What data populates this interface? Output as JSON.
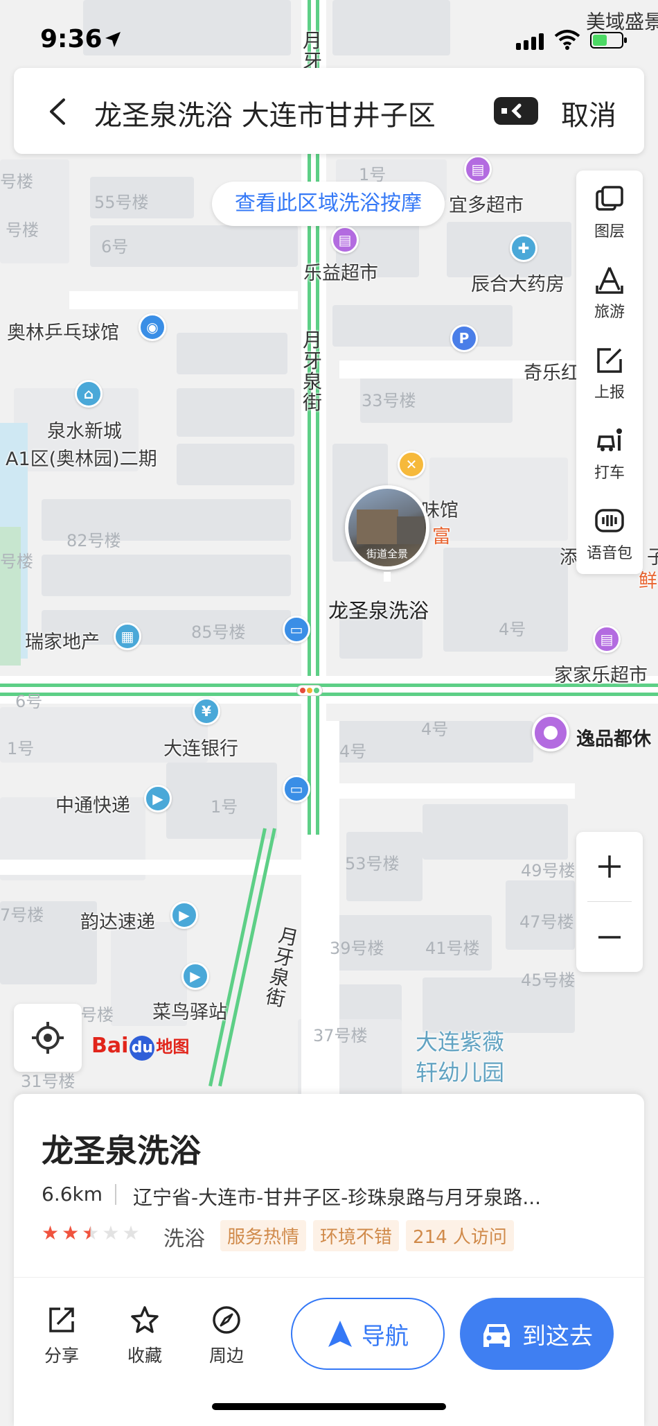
{
  "status_bar": {
    "time": "9:36",
    "top_right_text": "美域盛景"
  },
  "search": {
    "query": "龙圣泉洗浴 大连市甘井子区",
    "cancel_label": "取消"
  },
  "region_pill": "查看此区域洗浴按摩",
  "toolbar": [
    {
      "label": "图层",
      "icon": "layers-icon"
    },
    {
      "label": "旅游",
      "icon": "travel-icon"
    },
    {
      "label": "上报",
      "icon": "report-icon"
    },
    {
      "label": "打车",
      "icon": "taxi-icon"
    },
    {
      "label": "语音包",
      "icon": "voice-pack-icon"
    }
  ],
  "map": {
    "roads": {
      "main": "月牙泉街",
      "main_lower": "月牙泉街"
    },
    "pois": {
      "yiduo": "宜多超市",
      "leyi": "乐益超市",
      "chenhe": "辰合大药房",
      "aolin": "奥林乒乓球馆",
      "quanshui": "泉水新城",
      "quanshui2": "A1区(奥林园)二期",
      "qile": "奇乐红",
      "weiguan": "味馆",
      "fu": "富",
      "ruijia": "瑞家地产",
      "jiajiale": "家家乐超市",
      "dalianbank": "大连银行",
      "yipin": "逸品都休",
      "zhongtong": "中通快递",
      "yunda": "韵达速递",
      "cainiao": "菜鸟驿站",
      "kindergarten1": "大连紫薇",
      "kindergarten2": "轩幼儿园",
      "tian": "添",
      "zi": "子",
      "xian": "鲜"
    },
    "buildings": {
      "b1": "1号",
      "b55": "55号楼",
      "b6": "6号",
      "b33": "33号楼",
      "b82": "82号楼",
      "b85": "85号楼",
      "b4a": "4号",
      "b6b": "6号",
      "b4b": "4号",
      "b4c": "4号",
      "b1b": "1号",
      "b1c": "1号",
      "b53": "53号楼",
      "b49": "49号楼",
      "b47": "47号楼",
      "b39": "39号楼",
      "b41": "41号楼",
      "b45": "45号楼",
      "b37": "37号楼",
      "b31": "31号楼",
      "bl1": "号楼",
      "bl2": "号楼",
      "bl3": "号楼",
      "bl4": "号楼",
      "bl5": "号楼",
      "b7": "7号楼"
    },
    "pano_tag": "街道全景",
    "destination_label": "龙圣泉洗浴"
  },
  "logo": {
    "bai": "Bai",
    "du": "du",
    "ditu": "地图"
  },
  "card": {
    "name": "龙圣泉洗浴",
    "distance": "6.6km",
    "address": "辽宁省-大连市-甘井子区-珍珠泉路与月牙泉路...",
    "rating": 2.5,
    "category": "洗浴",
    "tags": [
      "服务热情",
      "环境不错",
      "214 人访问"
    ],
    "actions": [
      {
        "label": "分享",
        "icon": "share-icon"
      },
      {
        "label": "收藏",
        "icon": "star-icon"
      },
      {
        "label": "周边",
        "icon": "compass-icon"
      }
    ],
    "nav_label": "导航",
    "go_label": "到这去"
  },
  "colors": {
    "accent": "#3478f6",
    "star": "#f0533e",
    "road_green": "#5dcf86"
  }
}
